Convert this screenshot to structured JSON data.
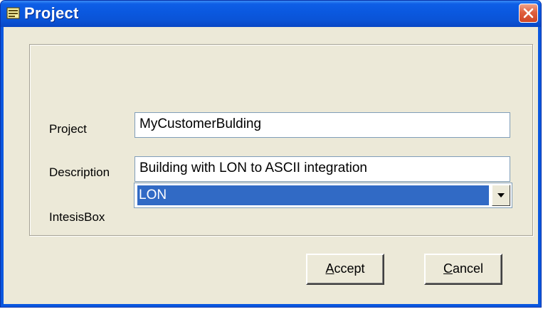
{
  "window": {
    "title": "Project",
    "icon": "card-icon",
    "close_icon": "close-icon"
  },
  "form": {
    "project": {
      "label": "Project",
      "value": "MyCustomerBulding"
    },
    "description": {
      "label": "Description",
      "value": "Building with LON to ASCII integration"
    },
    "intesisbox": {
      "label": "IntesisBox",
      "value": "LON"
    }
  },
  "buttons": {
    "accept": {
      "access_key": "A",
      "rest": "ccept"
    },
    "cancel": {
      "access_key": "C",
      "rest": "ancel"
    }
  },
  "colors": {
    "titlebar": "#0a58df",
    "client": "#ece9d8",
    "selection": "#316ac5",
    "close": "#e0603f"
  }
}
